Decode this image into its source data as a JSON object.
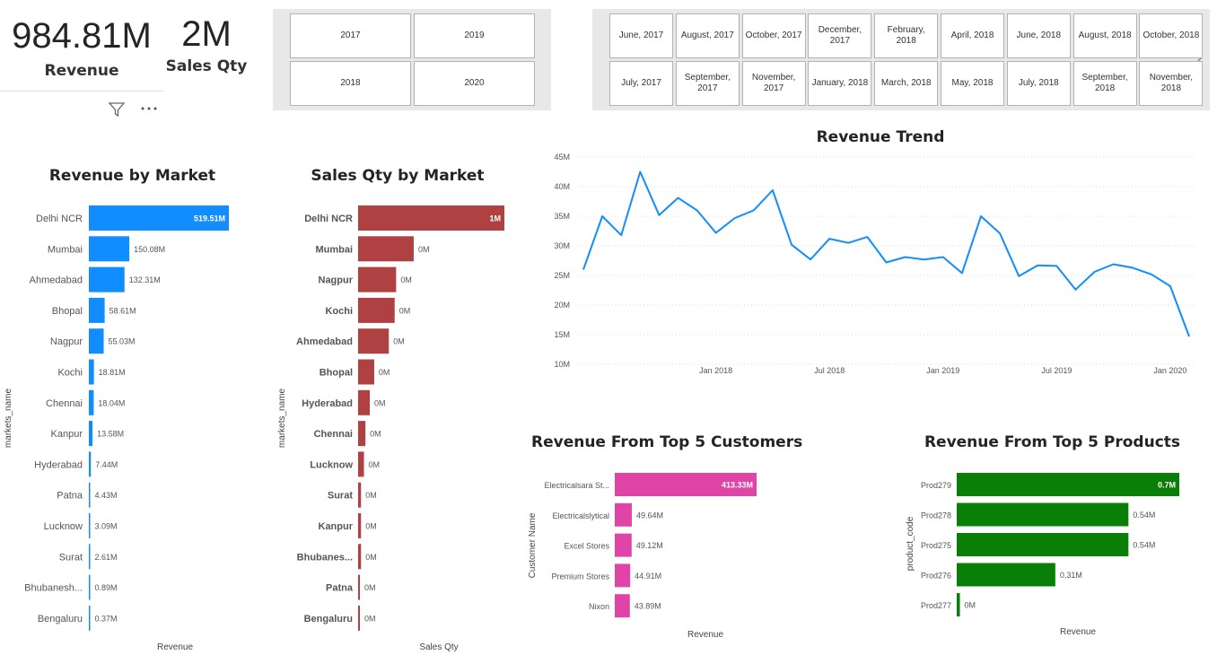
{
  "kpis": {
    "revenue": {
      "value": "984.81M",
      "label": "Revenue"
    },
    "sales_qty": {
      "value": "2M",
      "label": "Sales Qty"
    }
  },
  "year_slicer": {
    "items": [
      "2017",
      "2019",
      "2018",
      "2020"
    ]
  },
  "month_slicer": {
    "row1": [
      "June, 2017",
      "August, 2017",
      "October, 2017",
      "December, 2017",
      "February, 2018",
      "April, 2018",
      "June, 2018",
      "August, 2018",
      "October, 2018"
    ],
    "row2": [
      "July, 2017",
      "September, 2017",
      "November, 2017",
      "January, 2018",
      "March, 2018",
      "May, 2018",
      "July, 2018",
      "September, 2018",
      "November, 2018"
    ],
    "next_arrow": "›"
  },
  "icons": {
    "filter": "filter-icon",
    "more": "more-options-icon"
  },
  "colors": {
    "revenue_bar": "#118dff",
    "qty_bar": "#b04143",
    "customer_bar": "#e044a7",
    "product_bar": "#0a7f08",
    "trend_line": "#118dff"
  },
  "chart_data": [
    {
      "id": "revenue_by_market",
      "type": "bar",
      "orientation": "horizontal",
      "title": "Revenue by Market",
      "xlabel": "Revenue",
      "ylabel": "markets_name",
      "categories": [
        "Delhi NCR",
        "Mumbai",
        "Ahmedabad",
        "Bhopal",
        "Nagpur",
        "Kochi",
        "Chennai",
        "Kanpur",
        "Hyderabad",
        "Patna",
        "Lucknow",
        "Surat",
        "Bhubanesh...",
        "Bengaluru"
      ],
      "values": [
        519.51,
        150.08,
        132.31,
        58.61,
        55.03,
        18.81,
        18.04,
        13.58,
        7.44,
        4.43,
        3.09,
        2.61,
        0.89,
        0.37
      ],
      "labels": [
        "519.51M",
        "150.08M",
        "132.31M",
        "58.61M",
        "55.03M",
        "18.81M",
        "18.04M",
        "13.58M",
        "7.44M",
        "4.43M",
        "3.09M",
        "2.61M",
        "0.89M",
        "0.37M"
      ],
      "unit": "M"
    },
    {
      "id": "sales_qty_by_market",
      "type": "bar",
      "orientation": "horizontal",
      "title": "Sales Qty by Market",
      "xlabel": "Sales Qty",
      "ylabel": "markets_name",
      "categories": [
        "Delhi NCR",
        "Mumbai",
        "Nagpur",
        "Kochi",
        "Ahmedabad",
        "Bhopal",
        "Hyderabad",
        "Chennai",
        "Lucknow",
        "Surat",
        "Kanpur",
        "Bhubanes...",
        "Patna",
        "Bengaluru"
      ],
      "values": [
        1.0,
        0.38,
        0.26,
        0.25,
        0.21,
        0.11,
        0.08,
        0.05,
        0.04,
        0.02,
        0.02,
        0.02,
        0.01,
        0.01
      ],
      "labels": [
        "1M",
        "0M",
        "0M",
        "0M",
        "0M",
        "0M",
        "0M",
        "0M",
        "0M",
        "0M",
        "0M",
        "0M",
        "0M",
        "0M"
      ],
      "unit": "M"
    },
    {
      "id": "revenue_trend",
      "type": "line",
      "title": "Revenue Trend",
      "y_ticks": [
        "45M",
        "40M",
        "35M",
        "30M",
        "25M",
        "20M",
        "15M",
        "10M"
      ],
      "ylim": [
        10,
        45
      ],
      "x_ticks": [
        {
          "label": "Jan 2018",
          "month_index": 7
        },
        {
          "label": "Jul 2018",
          "month_index": 13
        },
        {
          "label": "Jan 2019",
          "month_index": 19
        },
        {
          "label": "Jul 2019",
          "month_index": 25
        },
        {
          "label": "Jan 2020",
          "month_index": 31
        }
      ],
      "x_months": [
        "2017-06",
        "2017-07",
        "2017-08",
        "2017-09",
        "2017-10",
        "2017-11",
        "2017-12",
        "2018-01",
        "2018-02",
        "2018-03",
        "2018-04",
        "2018-05",
        "2018-06",
        "2018-07",
        "2018-08",
        "2018-09",
        "2018-10",
        "2018-11",
        "2018-12",
        "2019-01",
        "2019-02",
        "2019-03",
        "2019-04",
        "2019-05",
        "2019-06",
        "2019-07",
        "2019-08",
        "2019-09",
        "2019-10",
        "2019-11",
        "2019-12",
        "2020-01",
        "2020-02",
        "2020-03",
        "2020-04",
        "2020-05",
        "2020-06"
      ],
      "values": [
        26.0,
        35.0,
        31.8,
        42.5,
        35.2,
        38.1,
        36.0,
        32.2,
        34.7,
        36.0,
        39.4,
        30.2,
        27.7,
        31.2,
        30.5,
        31.5,
        27.2,
        28.1,
        27.7,
        28.1,
        25.4,
        35.0,
        32.1,
        24.9,
        26.7,
        26.6,
        22.6,
        25.6,
        26.9,
        26.3,
        25.2,
        23.2,
        14.7
      ]
    },
    {
      "id": "revenue_top5_customers",
      "type": "bar",
      "orientation": "horizontal",
      "title": "Revenue From Top 5 Customers",
      "xlabel": "Revenue",
      "ylabel": "Customer Name",
      "categories": [
        "Electricalsara St...",
        "Electricalslytical",
        "Excel Stores",
        "Premium Stores",
        "Nixon"
      ],
      "values": [
        413.33,
        49.64,
        49.12,
        44.91,
        43.89
      ],
      "labels": [
        "413.33M",
        "49.64M",
        "49.12M",
        "44.91M",
        "43.89M"
      ],
      "unit": "M"
    },
    {
      "id": "revenue_top5_products",
      "type": "bar",
      "orientation": "horizontal",
      "title": "Revenue From Top 5 Products",
      "xlabel": "Revenue",
      "ylabel": "product_code",
      "categories": [
        "Prod279",
        "Prod278",
        "Prod275",
        "Prod276",
        "Prod277"
      ],
      "values": [
        0.7,
        0.54,
        0.54,
        0.31,
        0.01
      ],
      "labels": [
        "0.7M",
        "0.54M",
        "0.54M",
        "0.31M",
        "0M"
      ],
      "unit": "M"
    }
  ]
}
